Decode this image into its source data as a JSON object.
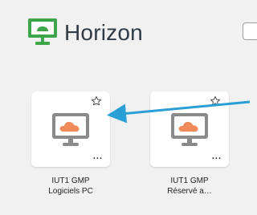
{
  "app": {
    "title": "Horizon",
    "brand_color": "#3da64a"
  },
  "tiles": [
    {
      "name_line1": "IUT1 GMP",
      "name_line2": "Logiciels PC",
      "icon": "monitor-cloud-icon",
      "favorite_icon": "star-outline-icon",
      "more_label": "..."
    },
    {
      "name_line1": "IUT1 GMP",
      "name_line2": "Réservé a…",
      "icon": "monitor-cloud-icon",
      "favorite_icon": "star-outline-icon",
      "more_label": "..."
    }
  ],
  "annotation": {
    "arrow_color": "#2a9fd6"
  },
  "colors": {
    "background": "#f1f1f1",
    "cloud": "#f08a5a",
    "monitor_screen": "#ffffff",
    "monitor_frame": "#8a8a8a"
  }
}
